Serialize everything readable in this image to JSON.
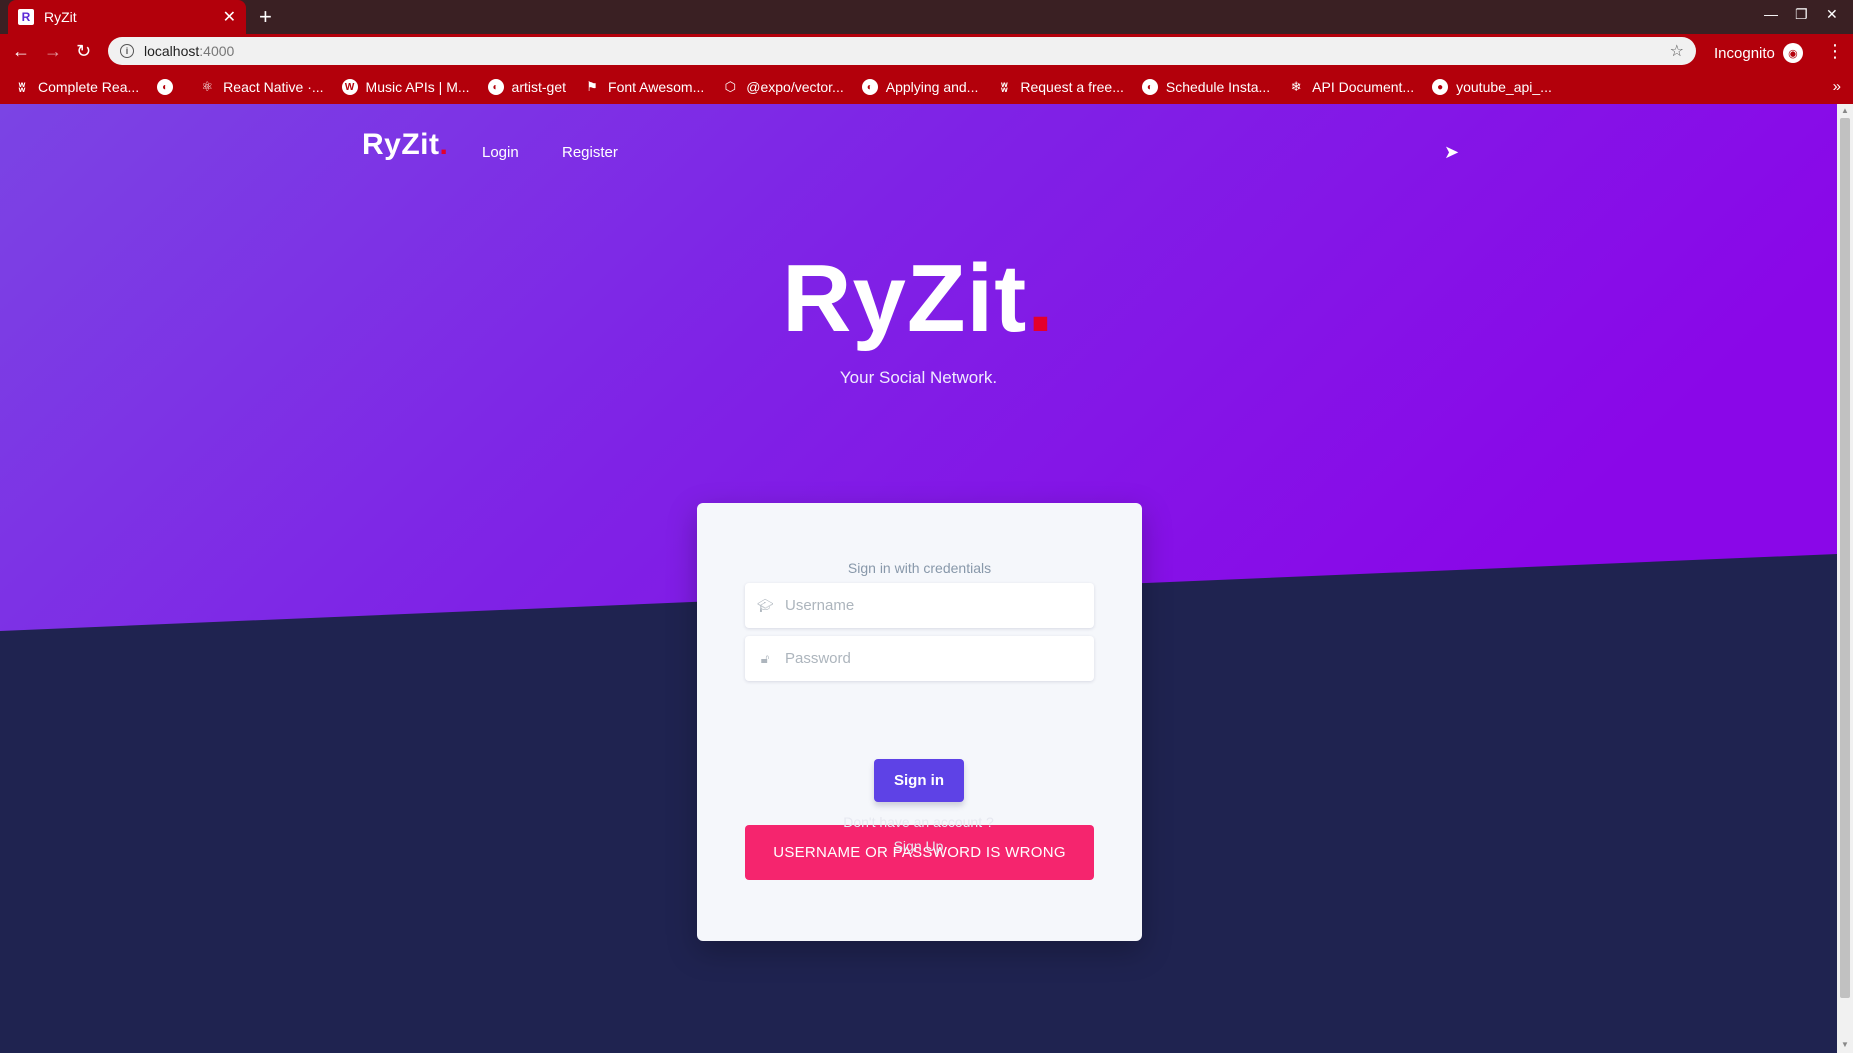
{
  "browser": {
    "tab_title": "RyZit",
    "tab_favicon": "R",
    "url_host": "localhost",
    "url_port": ":4000",
    "incognito_label": "Incognito",
    "bookmarks": [
      {
        "label": "Complete Rea...",
        "icon": "w"
      },
      {
        "label": "",
        "icon": "globe"
      },
      {
        "label": "React Native ·...",
        "icon": "react"
      },
      {
        "label": "Music APIs | M...",
        "icon": "wp"
      },
      {
        "label": "artist-get",
        "icon": "globe"
      },
      {
        "label": "Font Awesom...",
        "icon": "flag"
      },
      {
        "label": "@expo/vector...",
        "icon": "expo"
      },
      {
        "label": "Applying and...",
        "icon": "globe"
      },
      {
        "label": "Request a free...",
        "icon": "w"
      },
      {
        "label": "Schedule Insta...",
        "icon": "globe"
      },
      {
        "label": "API Document...",
        "icon": "snow"
      },
      {
        "label": "youtube_api_...",
        "icon": "github"
      }
    ]
  },
  "navbar": {
    "brand": "RyZit",
    "brand_dot": ".",
    "login": "Login",
    "register": "Register"
  },
  "hero": {
    "title": "RyZit",
    "dot": ".",
    "subtitle": "Your Social Network."
  },
  "login_card": {
    "heading": "Sign in with credentials",
    "username_placeholder": "Username",
    "password_placeholder": "Password",
    "signin_label": "Sign in",
    "error_message": "USERNAME OR PASSWORD IS WRONG"
  },
  "footer": {
    "no_account": "Don't have an account ?",
    "signup": "Sign Up"
  },
  "colors": {
    "hero_gradient_start": "#7a3fe0",
    "hero_gradient_end": "#8a07e8",
    "dark_bg": "#1f2350",
    "accent_red": "#e4002b",
    "button": "#5e42e6",
    "alert": "#f5256e"
  }
}
